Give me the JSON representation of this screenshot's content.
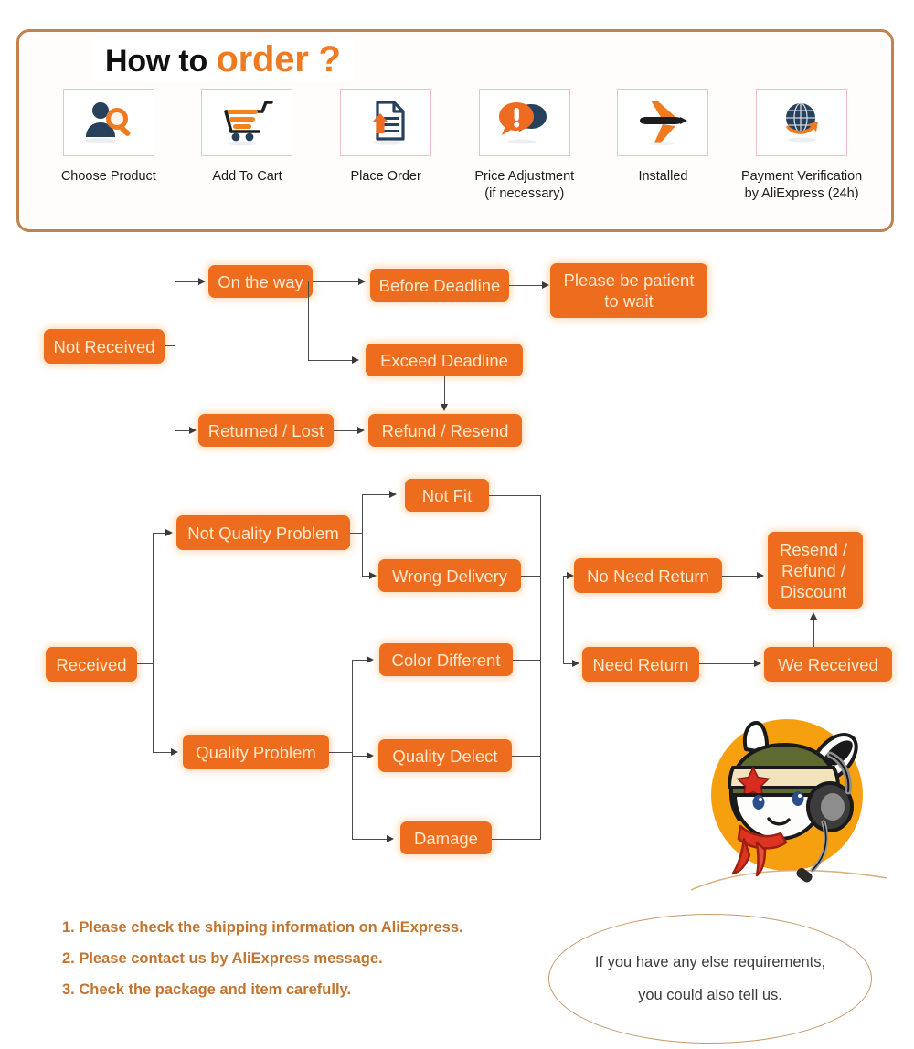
{
  "header": {
    "title_black": "How to ",
    "title_orange": "order ?",
    "steps": [
      {
        "label": "Choose Product",
        "icon": "person-search-icon"
      },
      {
        "label": "Add To Cart",
        "icon": "shopping-cart-icon"
      },
      {
        "label": "Place Order",
        "icon": "document-upload-icon"
      },
      {
        "label": "Price Adjustment\n(if necessary)",
        "icon": "chat-bubbles-alert-icon"
      },
      {
        "label": "Installed",
        "icon": "airplane-icon"
      },
      {
        "label": "Payment Verification\nby AliExpress (24h)",
        "icon": "globe-arrow-icon"
      }
    ]
  },
  "flow_not_received": {
    "root": "Not Received",
    "nodes": [
      "On the way",
      "Returned / Lost",
      "Before Deadline",
      "Exceed Deadline",
      "Refund / Resend",
      "Please be patient\nto wait"
    ]
  },
  "flow_received": {
    "root": "Received",
    "nodes": [
      "Not Quality Problem",
      "Quality Problem",
      "Not Fit",
      "Wrong Delivery",
      "Color Different",
      "Quality Delect",
      "Damage",
      "No Need Return",
      "Need Return",
      "Resend /\nRefund /\nDiscount",
      "We Received"
    ]
  },
  "notes": [
    "1. Please check the shipping information on AliExpress.",
    "2. Please contact us by AliExpress message.",
    "3. Check the package and item carefully."
  ],
  "bubble": {
    "line1": "If you have any else requirements,",
    "line2": "you could also tell us."
  },
  "colors": {
    "node_fill": "#ee6c1d",
    "node_text": "#fde9cf",
    "panel_border": "#c0834e",
    "title_orange": "#ef7a1f",
    "note_text": "#c27430",
    "icon_border": "#f0c0c4"
  }
}
